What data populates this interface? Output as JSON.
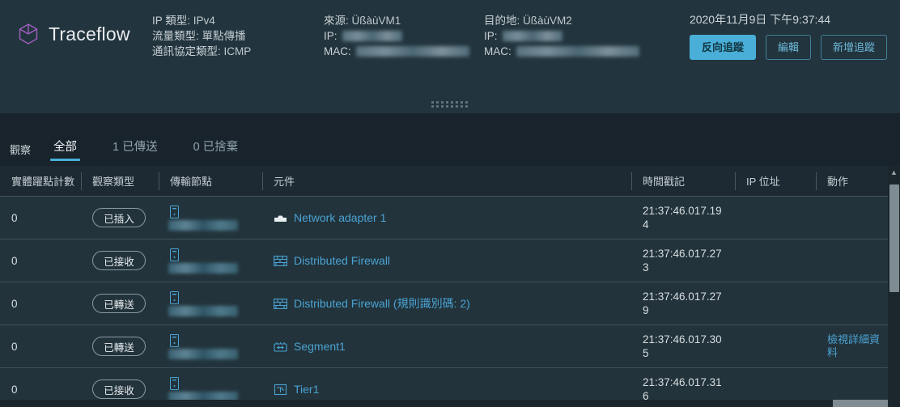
{
  "header": {
    "brand_icon": "cube-icon",
    "title": "Traceflow",
    "info_columns": [
      {
        "rows": [
          {
            "label": "IP 類型:",
            "value": "IPv4",
            "redacted": null
          },
          {
            "label": "流量類型:",
            "value": "單點傳播",
            "redacted": null
          },
          {
            "label": "通訊協定類型:",
            "value": "ICMP",
            "redacted": null
          }
        ]
      },
      {
        "rows": [
          {
            "label": "來源:",
            "value": "ÜßàùVM1",
            "redacted": null
          },
          {
            "label": "IP:",
            "value": "",
            "redacted": "ip"
          },
          {
            "label": "MAC:",
            "value": "",
            "redacted": "mac"
          }
        ]
      },
      {
        "rows": [
          {
            "label": "目的地:",
            "value": "ÜßàùVM2",
            "redacted": null
          },
          {
            "label": "IP:",
            "value": "",
            "redacted": "ip"
          },
          {
            "label": "MAC:",
            "value": "",
            "redacted": "mac"
          }
        ]
      }
    ],
    "timestamp": "2020年11月9日 下午9:37:44",
    "buttons": [
      {
        "label": "反向追蹤",
        "style": "primary"
      },
      {
        "label": "編輯",
        "style": "outline"
      },
      {
        "label": "新增追蹤",
        "style": "outline"
      }
    ]
  },
  "tabbar": {
    "group_label": "觀察",
    "tabs": [
      {
        "label": "全部",
        "active": true
      },
      {
        "label": "1 已傳送",
        "active": false
      },
      {
        "label": "0 已捨棄",
        "active": false
      }
    ]
  },
  "table": {
    "columns": [
      {
        "key": "hops",
        "label": "實體躍點計數"
      },
      {
        "key": "type",
        "label": "觀察類型"
      },
      {
        "key": "node",
        "label": "傳輸節點"
      },
      {
        "key": "component",
        "label": "元件"
      },
      {
        "key": "timestamp",
        "label": "時間戳記"
      },
      {
        "key": "ip",
        "label": "IP 位址"
      },
      {
        "key": "action",
        "label": "動作"
      }
    ],
    "rows": [
      {
        "hops": "0",
        "type": "已插入",
        "node_redacted": true,
        "component": "Network adapter 1",
        "component_icon": "network-adapter-icon",
        "timestamp": "21:37:46.017.194",
        "ip": "",
        "action": ""
      },
      {
        "hops": "0",
        "type": "已接收",
        "node_redacted": true,
        "component": "Distributed Firewall",
        "component_icon": "firewall-icon",
        "timestamp": "21:37:46.017.273",
        "ip": "",
        "action": ""
      },
      {
        "hops": "0",
        "type": "已轉送",
        "node_redacted": true,
        "component": "Distributed Firewall (規則識別碼: 2)",
        "component_icon": "firewall-icon",
        "timestamp": "21:37:46.017.279",
        "ip": "",
        "action": ""
      },
      {
        "hops": "0",
        "type": "已轉送",
        "node_redacted": true,
        "component": "Segment1",
        "component_icon": "segment-icon",
        "timestamp": "21:37:46.017.305",
        "ip": "",
        "action": "檢視詳細資料"
      },
      {
        "hops": "0",
        "type": "已接收",
        "node_redacted": true,
        "component": "Tier1",
        "component_icon": "tier1-router-icon",
        "timestamp": "21:37:46.017.316",
        "ip": "",
        "action": ""
      }
    ]
  },
  "colors": {
    "accent": "#49afd9",
    "link": "#4ba3d3",
    "brand_icon": "#a05fc0",
    "header_bg": "#22343d",
    "row_bg": "#22333b"
  }
}
